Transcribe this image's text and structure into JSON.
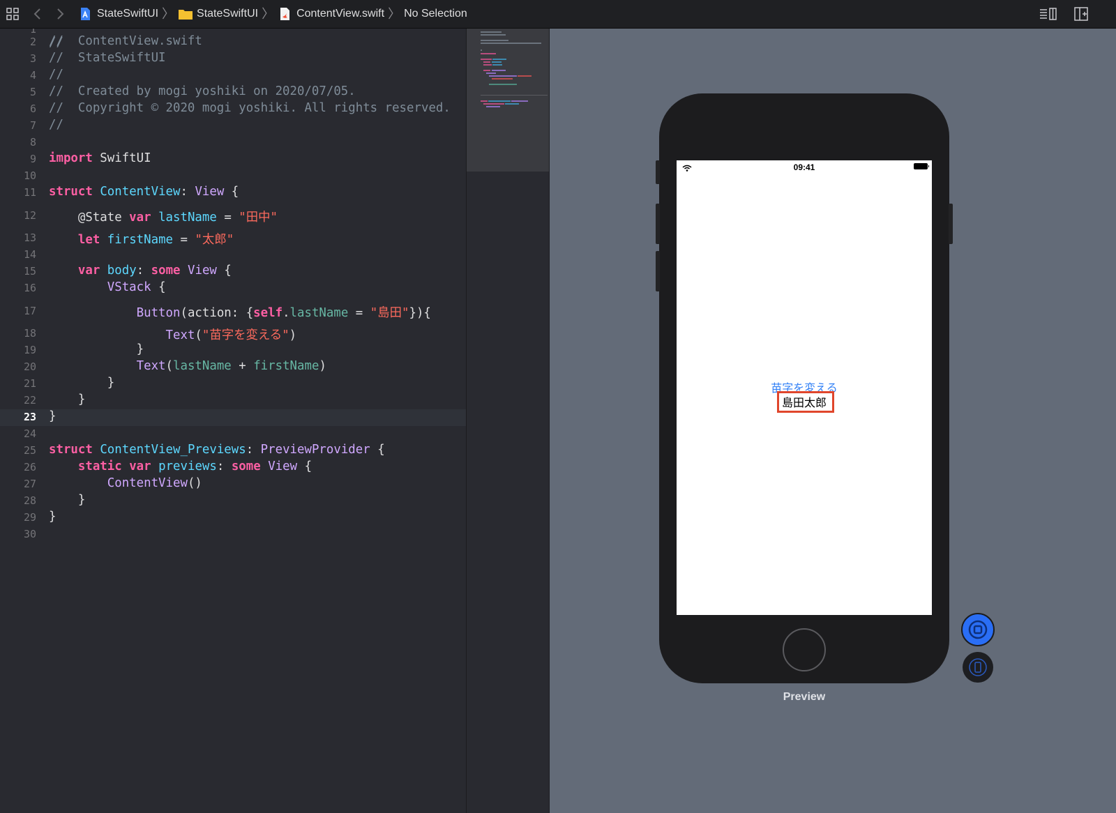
{
  "toolbar": {
    "breadcrumbs": [
      {
        "label": "StateSwiftUI",
        "icon": "project-icon"
      },
      {
        "label": "StateSwiftUI",
        "icon": "folder-icon"
      },
      {
        "label": "ContentView.swift",
        "icon": "swift-file-icon"
      },
      {
        "label": "No Selection"
      }
    ]
  },
  "editor": {
    "current_line": 23,
    "lines": [
      {
        "n": "2",
        "code": [
          {
            "t": "//  ContentView.swift",
            "c": "cm"
          }
        ]
      },
      {
        "n": "3",
        "code": [
          {
            "t": "//  StateSwiftUI",
            "c": "cm"
          }
        ]
      },
      {
        "n": "4",
        "code": [
          {
            "t": "//",
            "c": "cm"
          }
        ]
      },
      {
        "n": "5",
        "code": [
          {
            "t": "//  Created by mogi yoshiki on 2020/07/05.",
            "c": "cm"
          }
        ]
      },
      {
        "n": "6",
        "code": [
          {
            "t": "//  Copyright © 2020 mogi yoshiki. All rights reserved.",
            "c": "cm"
          }
        ]
      },
      {
        "n": "7",
        "code": [
          {
            "t": "//",
            "c": "cm"
          }
        ]
      },
      {
        "n": "8",
        "code": []
      },
      {
        "n": "9",
        "code": [
          {
            "t": "import",
            "c": "kw"
          },
          {
            "t": " SwiftUI",
            "c": "pl"
          }
        ]
      },
      {
        "n": "10",
        "code": []
      },
      {
        "n": "11",
        "code": [
          {
            "t": "struct",
            "c": "kw"
          },
          {
            "t": " ",
            "c": "pl"
          },
          {
            "t": "ContentView",
            "c": "ty"
          },
          {
            "t": ": ",
            "c": "pl"
          },
          {
            "t": "View",
            "c": "tp"
          },
          {
            "t": " {",
            "c": "pl"
          }
        ]
      },
      {
        "n": "12",
        "code": [
          {
            "t": "    @State ",
            "c": "at"
          },
          {
            "t": "var",
            "c": "kw"
          },
          {
            "t": " ",
            "c": "pl"
          },
          {
            "t": "lastName",
            "c": "ty"
          },
          {
            "t": " = ",
            "c": "pl"
          },
          {
            "t": "\"田中\"",
            "c": "st"
          }
        ]
      },
      {
        "n": "13",
        "code": [
          {
            "t": "    ",
            "c": "pl"
          },
          {
            "t": "let",
            "c": "kw"
          },
          {
            "t": " ",
            "c": "pl"
          },
          {
            "t": "firstName",
            "c": "ty"
          },
          {
            "t": " = ",
            "c": "pl"
          },
          {
            "t": "\"太郎\"",
            "c": "st"
          }
        ]
      },
      {
        "n": "14",
        "code": []
      },
      {
        "n": "15",
        "code": [
          {
            "t": "    ",
            "c": "pl"
          },
          {
            "t": "var",
            "c": "kw"
          },
          {
            "t": " ",
            "c": "pl"
          },
          {
            "t": "body",
            "c": "ty"
          },
          {
            "t": ": ",
            "c": "pl"
          },
          {
            "t": "some",
            "c": "kw"
          },
          {
            "t": " ",
            "c": "pl"
          },
          {
            "t": "View",
            "c": "tp"
          },
          {
            "t": " {",
            "c": "pl"
          }
        ]
      },
      {
        "n": "16",
        "code": [
          {
            "t": "        ",
            "c": "pl"
          },
          {
            "t": "VStack",
            "c": "tp"
          },
          {
            "t": " {",
            "c": "pl"
          }
        ]
      },
      {
        "n": "17",
        "code": [
          {
            "t": "            ",
            "c": "pl"
          },
          {
            "t": "Button",
            "c": "tp"
          },
          {
            "t": "(action: {",
            "c": "pl"
          },
          {
            "t": "self",
            "c": "kw"
          },
          {
            "t": ".",
            "c": "pl"
          },
          {
            "t": "lastName",
            "c": "pr"
          },
          {
            "t": " = ",
            "c": "pl"
          },
          {
            "t": "\"島田\"",
            "c": "st"
          },
          {
            "t": "}){",
            "c": "pl"
          }
        ]
      },
      {
        "n": "18",
        "code": [
          {
            "t": "                ",
            "c": "pl"
          },
          {
            "t": "Text",
            "c": "tp"
          },
          {
            "t": "(",
            "c": "pl"
          },
          {
            "t": "\"苗字を変える\"",
            "c": "st"
          },
          {
            "t": ")",
            "c": "pl"
          }
        ]
      },
      {
        "n": "19",
        "code": [
          {
            "t": "            }",
            "c": "pl"
          }
        ]
      },
      {
        "n": "20",
        "code": [
          {
            "t": "            ",
            "c": "pl"
          },
          {
            "t": "Text",
            "c": "tp"
          },
          {
            "t": "(",
            "c": "pl"
          },
          {
            "t": "lastName",
            "c": "pr"
          },
          {
            "t": " + ",
            "c": "pl"
          },
          {
            "t": "firstName",
            "c": "pr"
          },
          {
            "t": ")",
            "c": "pl"
          }
        ]
      },
      {
        "n": "21",
        "code": [
          {
            "t": "        }",
            "c": "pl"
          }
        ]
      },
      {
        "n": "22",
        "code": [
          {
            "t": "    }",
            "c": "pl"
          }
        ]
      },
      {
        "n": "23",
        "code": [
          {
            "t": "}",
            "c": "pl"
          }
        ]
      },
      {
        "n": "24",
        "code": []
      },
      {
        "n": "25",
        "code": [
          {
            "t": "struct",
            "c": "kw"
          },
          {
            "t": " ",
            "c": "pl"
          },
          {
            "t": "ContentView_Previews",
            "c": "ty"
          },
          {
            "t": ": ",
            "c": "pl"
          },
          {
            "t": "PreviewProvider",
            "c": "tp"
          },
          {
            "t": " {",
            "c": "pl"
          }
        ]
      },
      {
        "n": "26",
        "code": [
          {
            "t": "    ",
            "c": "pl"
          },
          {
            "t": "static",
            "c": "kw"
          },
          {
            "t": " ",
            "c": "pl"
          },
          {
            "t": "var",
            "c": "kw"
          },
          {
            "t": " ",
            "c": "pl"
          },
          {
            "t": "previews",
            "c": "ty"
          },
          {
            "t": ": ",
            "c": "pl"
          },
          {
            "t": "some",
            "c": "kw"
          },
          {
            "t": " ",
            "c": "pl"
          },
          {
            "t": "View",
            "c": "tp"
          },
          {
            "t": " {",
            "c": "pl"
          }
        ]
      },
      {
        "n": "27",
        "code": [
          {
            "t": "        ",
            "c": "pl"
          },
          {
            "t": "ContentView",
            "c": "tp"
          },
          {
            "t": "()",
            "c": "pl"
          }
        ]
      },
      {
        "n": "28",
        "code": [
          {
            "t": "    }",
            "c": "pl"
          }
        ]
      },
      {
        "n": "29",
        "code": [
          {
            "t": "}",
            "c": "pl"
          }
        ]
      },
      {
        "n": "30",
        "code": []
      }
    ]
  },
  "preview": {
    "status_time": "09:41",
    "button_text": "苗字を変える",
    "name_text": "島田太郎",
    "label": "Preview"
  },
  "colors": {
    "editor_bg": "#292a30",
    "preview_bg": "#636b78",
    "keyword": "#fc5fa3",
    "string": "#fc6a5d",
    "type": "#5dd8ff",
    "comment": "#7f8c98",
    "accent_blue": "#2a6ef5",
    "highlight_red": "#e0462c"
  }
}
